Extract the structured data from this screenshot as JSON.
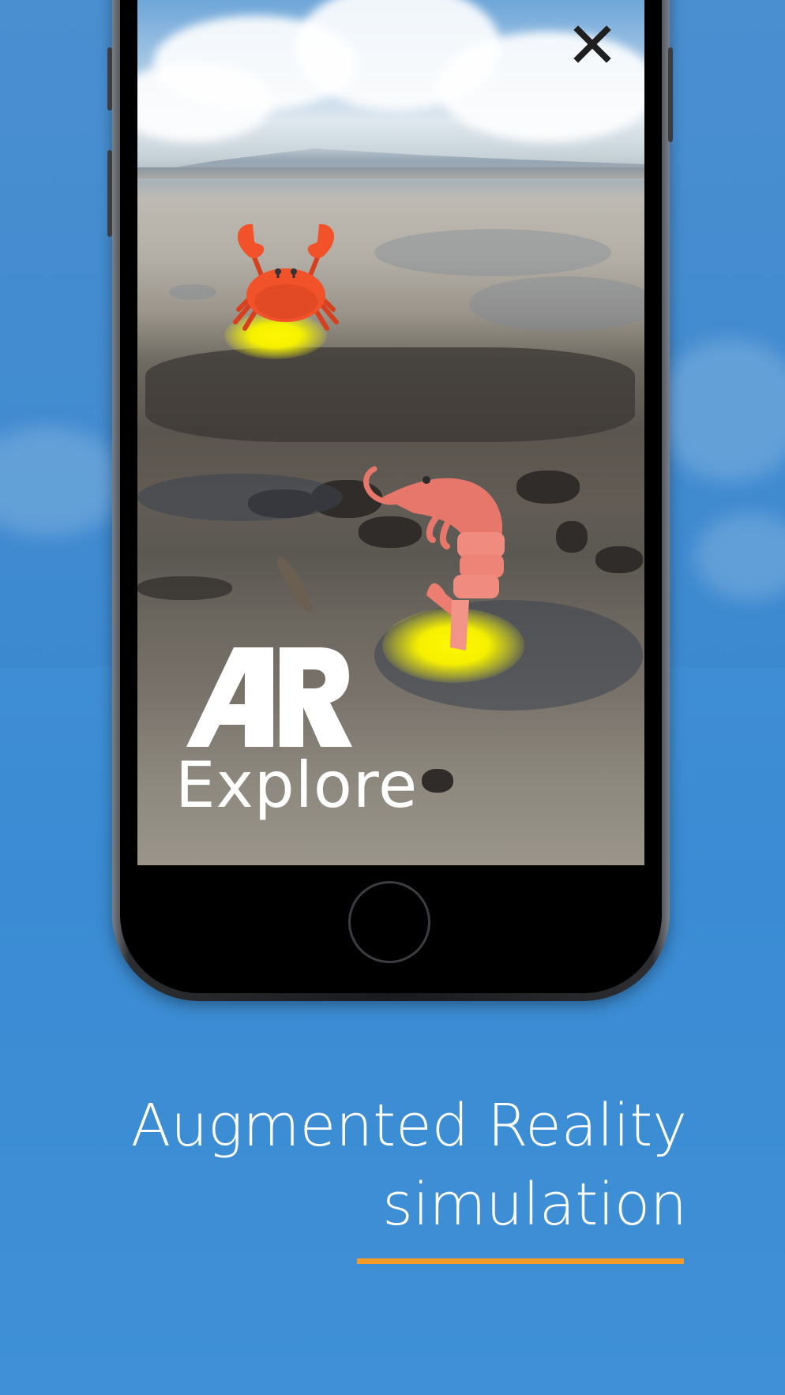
{
  "screen": {
    "close_icon": "close-icon",
    "ar_logo_text": "AR",
    "explore_label": "Explore",
    "creatures": [
      "crab-icon",
      "shrimp-icon"
    ],
    "marker_color": "#fff700"
  },
  "device": {
    "home_button_icon": "home-button"
  },
  "caption": {
    "line1": "Augmented Reality",
    "line2": "simulation",
    "accent_color": "#f39a27"
  }
}
